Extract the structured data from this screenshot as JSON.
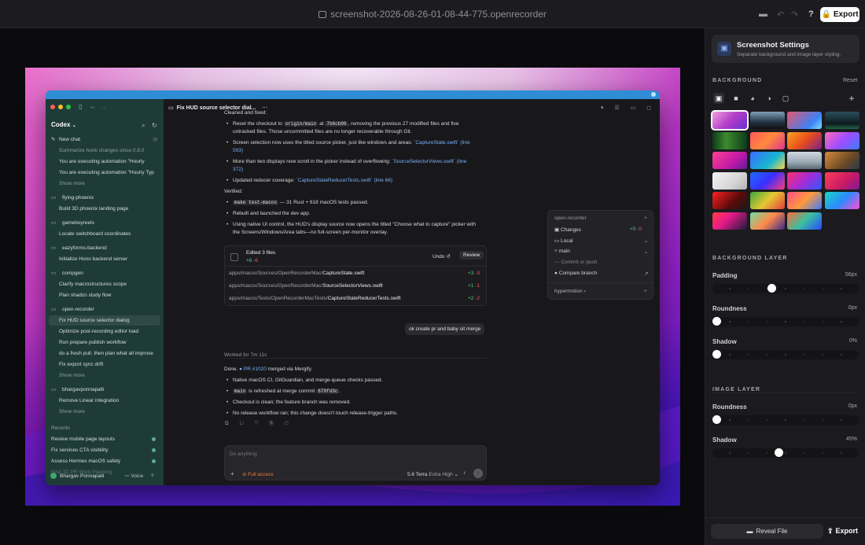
{
  "window": {
    "title": "screenshot-2026-08-26-01-08-44-775.openrecorder",
    "export_label": "Export",
    "help_label": "?"
  },
  "codex": {
    "app_title": "Codex",
    "new_chat": "New chat",
    "thread_title": "Fix HUD source selector dial...",
    "sidebar": [
      {
        "type": "muted",
        "text": "Summarize hook changes since 0.8.0"
      },
      {
        "type": "item",
        "text": "You are executing automation \"Hourly"
      },
      {
        "type": "item",
        "text": "You are executing automation \"Hourly Typ"
      },
      {
        "type": "muted",
        "text": "Show more"
      },
      {
        "type": "proj",
        "text": "flying-phoenix"
      },
      {
        "type": "item",
        "text": "Build 3D phoenix landing page"
      },
      {
        "type": "proj",
        "text": "gameboyreels"
      },
      {
        "type": "item",
        "text": "Locate switchboard coordinates"
      },
      {
        "type": "proj",
        "text": "eazyforms-backend"
      },
      {
        "type": "item",
        "text": "Initialize Hono backend server"
      },
      {
        "type": "proj",
        "text": "compgen"
      },
      {
        "type": "item",
        "text": "Clarify macrostructures scope"
      },
      {
        "type": "item",
        "text": "Plan shadcn study flow"
      },
      {
        "type": "proj",
        "text": "open-recorder"
      },
      {
        "type": "active",
        "text": "Fix HUD source selector dialog"
      },
      {
        "type": "item",
        "text": "Optimize post-recording editor load"
      },
      {
        "type": "item",
        "text": "Run prepare publish workflow"
      },
      {
        "type": "item",
        "text": "do a fresh pull. then plan what all improve"
      },
      {
        "type": "item",
        "text": "Fix export sync drift"
      },
      {
        "type": "muted",
        "text": "Show more"
      },
      {
        "type": "proj",
        "text": "bhargavponnapalli"
      },
      {
        "type": "item",
        "text": "Remove Linear integration"
      },
      {
        "type": "muted",
        "text": "Show more"
      }
    ],
    "recents_label": "Recents",
    "recents": [
      "Review mobile page layouts",
      "Fix services CTA visibility",
      "Assess Hermes macOS safety",
      "Find 3D PR Work Planning"
    ],
    "user_name": "Bhargav Ponnapalli",
    "voice_label": "Voice",
    "messages": {
      "l1": "Cleaned and fixed:",
      "b1a": "Reset the checkout to",
      "b1code1": "origin/main",
      "b1at": "at",
      "b1code2": "7b6cb06",
      "b1b": ", removing the previous 27 modified files and five",
      "b1c": "untracked files. Those uncommitted files are no longer recoverable through Git.",
      "b2a": "Screen selection now uses the titled source picker, just like windows and areas:",
      "b2link": "`CaptureState.swift` (line",
      "b2c": "593)",
      "b3a": "More than two displays now scroll in the picker instead of overflowing:",
      "b3link": "`SourceSelectorViews.swift` (line",
      "b3c": "372)",
      "b4a": "Updated reducer coverage:",
      "b4link": "`CaptureStateReducerTests.swift` (line 66)",
      "verified": "Verified:",
      "v1code": "make test-macos",
      "v1": "— 31 Rust + 618 macOS tests passed.",
      "v2": "Rebuilt and launched the dev app.",
      "v3a": "Using native UI control, the HUD's display source now opens the titled \"Choose what to capture\" picker with",
      "v3b": "the Screens/Windows/Area tabs—no full-screen per-monitor overlay.",
      "edited": "Edited 3 files",
      "edited_add": "+6",
      "edited_del": "-6",
      "undo": "Undo",
      "review": "Review",
      "files": [
        {
          "dir": "apps/macos/Sources/OpenRecorderMac/",
          "name": "CaptureState.swift",
          "add": "+3",
          "del": "-3"
        },
        {
          "dir": "apps/macos/Sources/OpenRecorderMac/",
          "name": "SourceSelectorViews.swift",
          "add": "+1",
          "del": "-1"
        },
        {
          "dir": "apps/macos/Tests/OpenRecorderMacTests/",
          "name": "CaptureStateReducerTests.swift",
          "add": "+2",
          "del": "-2"
        }
      ],
      "user_msg": "ok create pr and baby sit merge",
      "worked": "Worked for 7m 11s",
      "done_a": "Done.",
      "done_pr": "PR #1020",
      "done_b": "merged via Mergify.",
      "d1": "Native macOS CI, GitGuardian, and merge-queue checks passed.",
      "d2code1": "main",
      "d2a": "is refreshed at merge commit",
      "d2code2": "679fd3c",
      "d2b": ".",
      "d3": "Checkout is clean; the feature branch was removed.",
      "d4": "No release workflow ran; this change doesn't touch release-trigger paths."
    },
    "composer": {
      "placeholder": "Do anything",
      "access": "Full access",
      "model": "5.6 Terra",
      "effort": "Extra High"
    },
    "popover": {
      "project": "open-recorder",
      "changes": "Changes",
      "add": "+0",
      "del": "-0",
      "local": "Local",
      "branch": "main",
      "commit": "Commit or push",
      "compare": "Compare branch",
      "footer": "hypermotion"
    }
  },
  "panel": {
    "title": "Screenshot Settings",
    "subtitle": "Separate background and image layer styling.",
    "background_label": "BACKGROUND",
    "reset_label": "Reset",
    "bg_layer_label": "BACKGROUND LAYER",
    "image_layer_label": "IMAGE LAYER",
    "controls": [
      {
        "label": "Padding",
        "value": "56px",
        "fraction": 0.4
      },
      {
        "label": "Roundness",
        "value": "0px",
        "fraction": 0.0
      },
      {
        "label": "Shadow",
        "value": "0%",
        "fraction": 0.0
      }
    ],
    "image_controls": [
      {
        "label": "Roundness",
        "value": "0px",
        "fraction": 0.0
      },
      {
        "label": "Shadow",
        "value": "45%",
        "fraction": 0.45
      }
    ],
    "wallpapers": [
      "linear-gradient(135deg,#f2a1e0,#b43ec8 50%,#6b2fd0)",
      "linear-gradient(180deg,#7f9fb8,#233443 60%,#111)",
      "linear-gradient(135deg,#e6556d,#3b82f6 70%,#7ee0ff)",
      "linear-gradient(180deg,#2b4e5a,#0e1a1f 70%,#264)",
      "linear-gradient(90deg,#0d3b1a,#3d8b2e 40%,#0d3b1a)",
      "linear-gradient(135deg,#ff5a5a,#ff8a3d 50%,#e0348f)",
      "linear-gradient(135deg,#f5a623,#e94e1b 50%,#7a1f8f)",
      "linear-gradient(135deg,#ff6bb5,#a14dff 50%,#3a7bff)",
      "linear-gradient(135deg,#ff3f8e,#c21aa6 60%,#601a9c)",
      "linear-gradient(135deg,#3b6cff,#18b7d1 60%,#ffd24a)",
      "linear-gradient(180deg,#cfd8de,#9aa9b3 60%,#5d6a73)",
      "linear-gradient(135deg,#d88a3a,#6b4a24 60%,#2a3a4a)",
      "linear-gradient(135deg,#f4f4f4,#d6d6d6 60%,#b2b2b2)",
      "linear-gradient(135deg,#1b6cff,#3b2fff 50%,#ff3b7d)",
      "linear-gradient(135deg,#ff2d6f,#a52bd6 50%,#2b59ff)",
      "linear-gradient(135deg,#ff3c5a,#c51a66 60%,#7a1a9a)",
      "linear-gradient(135deg,#ff2020,#5a0a0a 60%,#1a1a1a)",
      "linear-gradient(135deg,#3ca63c,#e6c832 50%,#e23c3c)",
      "linear-gradient(135deg,#ff4d8a,#ff9a3c 50%,#3c7bff)",
      "linear-gradient(135deg,#1ad6c2,#2b8cff 50%,#ff4dd6)",
      "linear-gradient(135deg,#ff4040,#e81a8a 40%,#1a1a3a)",
      "linear-gradient(135deg,#6ee0a0,#ff8a4a 50%,#3a2a8a)",
      "linear-gradient(135deg,#ff6a3a,#3ac0a0 50%,#2a4aff)"
    ],
    "reveal_label": "Reveal File",
    "export_label": "Export"
  }
}
